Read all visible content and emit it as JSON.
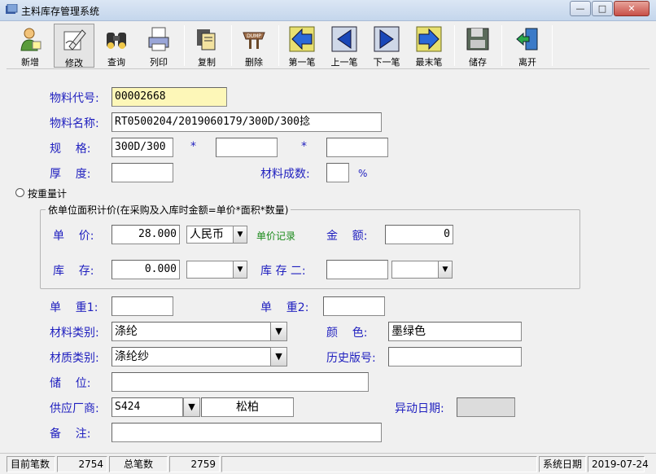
{
  "window": {
    "title": "主料库存管理系统",
    "controls": {
      "minimize": "—",
      "maximize": "□",
      "close": "✕"
    }
  },
  "toolbar": {
    "buttons": [
      {
        "label": "新增",
        "icon": "new-person-icon"
      },
      {
        "label": "修改",
        "icon": "edit-pen-icon"
      },
      {
        "label": "查询",
        "icon": "binoculars-icon"
      },
      {
        "label": "列印",
        "icon": "printer-icon"
      },
      {
        "label": "复制",
        "icon": "copy-icon"
      },
      {
        "label": "删除",
        "icon": "dump-delete-icon",
        "icon_text": "DUMP"
      },
      {
        "label": "第一笔",
        "icon": "first-record-icon"
      },
      {
        "label": "上一笔",
        "icon": "prev-record-icon"
      },
      {
        "label": "下一笔",
        "icon": "next-record-icon"
      },
      {
        "label": "最末笔",
        "icon": "last-record-icon"
      },
      {
        "label": "储存",
        "icon": "save-floppy-icon"
      },
      {
        "label": "离开",
        "icon": "exit-door-icon"
      }
    ]
  },
  "form": {
    "material_code": {
      "label": "物料代号:",
      "value": "00002668"
    },
    "material_name": {
      "label": "物料名称:",
      "value": "RT0500204/2019060179/300D/300捻"
    },
    "spec": {
      "label": "规    格:",
      "value1": "300D/300",
      "star1": "*",
      "value2": "",
      "star2": "*",
      "value3": ""
    },
    "thickness": {
      "label": "厚    度:",
      "value": ""
    },
    "material_count": {
      "label": "材料成数:",
      "value": "",
      "unit": "%"
    },
    "by_weight": {
      "label": "按重量计"
    },
    "area_group": {
      "title": "依单位面积计价(在采购及入库时金额=单价*面积*数量)",
      "unit_price": {
        "label": "单    价:",
        "value": "28.000",
        "currency": "人民币",
        "link": "单价记录"
      },
      "amount": {
        "label": "金    额:",
        "value": "0"
      },
      "stock": {
        "label": "库    存:",
        "value": "0.000",
        "unit": ""
      },
      "stock2": {
        "label": "库 存 二:",
        "value": "",
        "unit": ""
      }
    },
    "unit_weight1": {
      "label": "单    重1:",
      "value": ""
    },
    "unit_weight2": {
      "label": "单    重2:",
      "value": ""
    },
    "material_category": {
      "label": "材料类别:",
      "value": "涤纶"
    },
    "color": {
      "label": "颜    色:",
      "value": "墨绿色"
    },
    "quality_category": {
      "label": "材质类别:",
      "value": "涤纶纱"
    },
    "history_version": {
      "label": "历史版号:",
      "value": ""
    },
    "storage_location": {
      "label": "储    位:",
      "value": ""
    },
    "supplier": {
      "label": "供应厂商:",
      "code": "S424",
      "name": "松柏"
    },
    "change_date": {
      "label": "异动日期:",
      "value": ""
    },
    "remark": {
      "label": "备    注:",
      "value": ""
    }
  },
  "statusbar": {
    "current_label": "目前笔数",
    "current_value": "2754",
    "total_label": "总笔数",
    "total_value": "2759",
    "date_label": "系统日期",
    "date_value": "2019-07-24"
  }
}
